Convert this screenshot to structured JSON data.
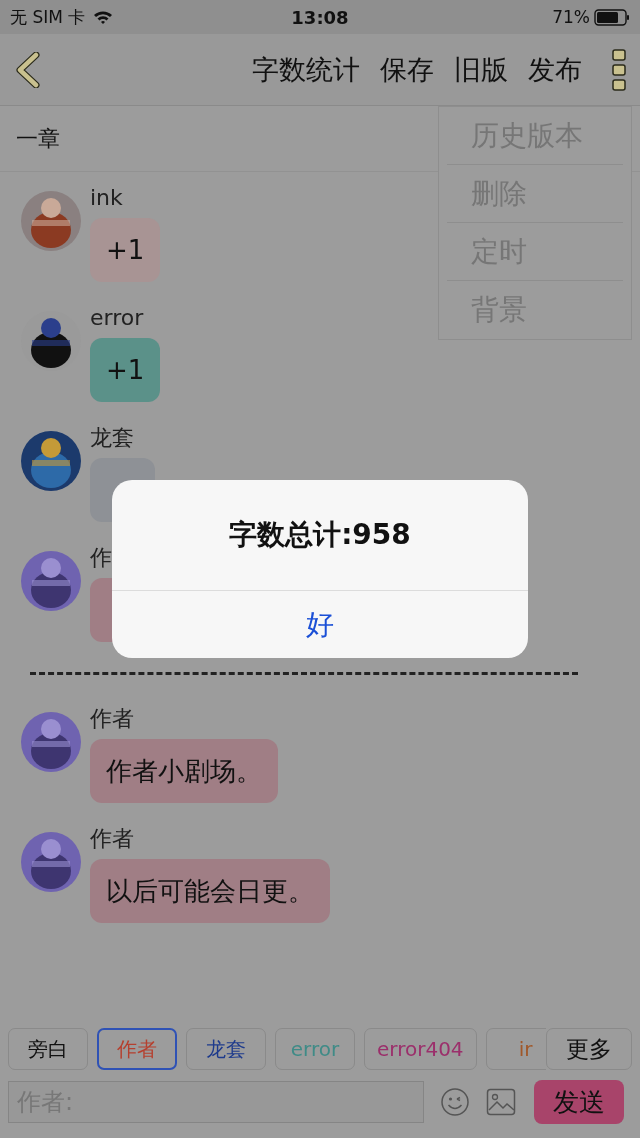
{
  "status_bar": {
    "carrier": "无 SIM 卡",
    "time": "13:08",
    "battery": "71%"
  },
  "nav": {
    "actions": [
      "字数统计",
      "保存",
      "旧版",
      "发布"
    ]
  },
  "chapter": {
    "title": "一章"
  },
  "menu": {
    "items": [
      "历史版本",
      "删除",
      "定时",
      "背景"
    ]
  },
  "messages": [
    {
      "sender": "ink",
      "text": "+1",
      "color": "#a89494"
    },
    {
      "sender": "error",
      "text": "+1",
      "color": "#5b9189"
    },
    {
      "sender": "龙套",
      "color": "#8e9196",
      "wide": false
    },
    {
      "sender": "作",
      "color": "#a07e85",
      "wide": true
    },
    {
      "kind": "separator"
    },
    {
      "sender": "作者",
      "text": "作者小剧场。",
      "color": "#a07e85"
    },
    {
      "sender": "作者",
      "text": "以后可能会日更。",
      "color": "#a07e85"
    }
  ],
  "roles": [
    {
      "label": "旁白",
      "color": "#111111",
      "selected": false
    },
    {
      "label": "作者",
      "color": "#b5402f",
      "selected": true
    },
    {
      "label": "龙套",
      "color": "#1d3a8c",
      "selected": false
    },
    {
      "label": "error",
      "color": "#3f8b87",
      "selected": false
    },
    {
      "label": "error404",
      "color": "#9b2f6b",
      "selected": false
    },
    {
      "label": "ir",
      "color": "#a0582a",
      "selected": false
    }
  ],
  "more_button": "更多",
  "input": {
    "placeholder": "作者:"
  },
  "send_button": "发送",
  "dialog": {
    "title": "字数总计:958",
    "button": "好"
  }
}
